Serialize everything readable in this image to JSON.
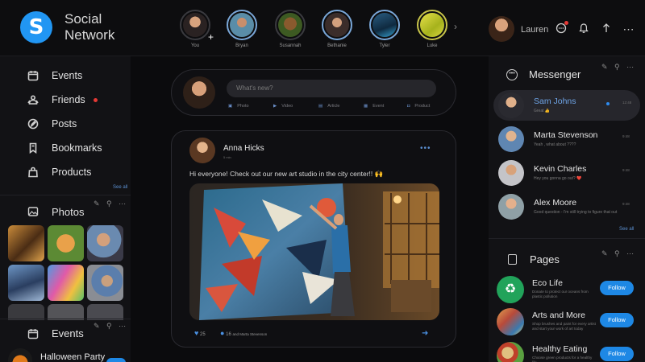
{
  "header": {
    "app_name": "Social\nNetwork",
    "logo_letter": "S",
    "stories": [
      {
        "name": "You",
        "add": "+"
      },
      {
        "name": "Bryan"
      },
      {
        "name": "Susannah"
      },
      {
        "name": "Bethanie"
      },
      {
        "name": "Tyler"
      },
      {
        "name": "Luke"
      }
    ],
    "next_icon": "›",
    "user_name": "Lauren",
    "icons": [
      "chat-icon",
      "bell-icon",
      "upload-icon",
      "more-icon"
    ]
  },
  "sidebar": {
    "nav": [
      {
        "label": "Events",
        "icon": "calendar-icon"
      },
      {
        "label": "Friends",
        "icon": "friends-icon"
      },
      {
        "label": "Posts",
        "icon": "edit-icon"
      },
      {
        "label": "Bookmarks",
        "icon": "bookmark-icon"
      },
      {
        "label": "Products",
        "icon": "bag-icon"
      }
    ],
    "see_all": "See all",
    "photos_title": "Photos",
    "photos_tools": "✎ ⚲ ⋯",
    "events_title": "Events",
    "events_tools": "✎ ⚲ ⋯",
    "event_item": "Halloween Party"
  },
  "composer": {
    "placeholder": "What's new?",
    "actions": [
      "Photo",
      "Video",
      "Article",
      "Event",
      "Product"
    ]
  },
  "post": {
    "author": "Anna Hicks",
    "time": "5 min",
    "text": "Hi everyone! Check out our new art studio in the city center!! 🙌",
    "likes": "25",
    "comments": "16",
    "comment_text": "and Marta Stevenson"
  },
  "messenger": {
    "title": "Messenger",
    "tools": "✎ ⚲ ⋯",
    "see_all": "See all",
    "threads": [
      {
        "name": "Sam Johns",
        "preview": "Great 👍",
        "time": "12:48"
      },
      {
        "name": "Marta Stevenson",
        "preview": "Yeah , what about ????",
        "time": "9:48"
      },
      {
        "name": "Kevin Charles",
        "preview": "Hey you gonna go out? ❤️",
        "time": "9:48"
      },
      {
        "name": "Alex Moore",
        "preview": "Good question - I'm still trying to figure that out",
        "time": "9:48"
      }
    ]
  },
  "pages": {
    "title": "Pages",
    "tools": "✎ ⚲ ⋯",
    "items": [
      {
        "name": "Eco Life",
        "desc": "Donate to protect our oceans from plastic pollution",
        "button": "Follow"
      },
      {
        "name": "Arts and More",
        "desc": "Shop brushes and paint for every artist and start your work of art today",
        "button": "Follow"
      },
      {
        "name": "Healthy Eating",
        "desc": "Choose green products for a healthy life",
        "button": "Follow"
      }
    ]
  },
  "colors": {
    "accent": "#2196f3",
    "follow": "#1e88e5",
    "bg": "#0b0b0d",
    "notification": "#e53935"
  }
}
